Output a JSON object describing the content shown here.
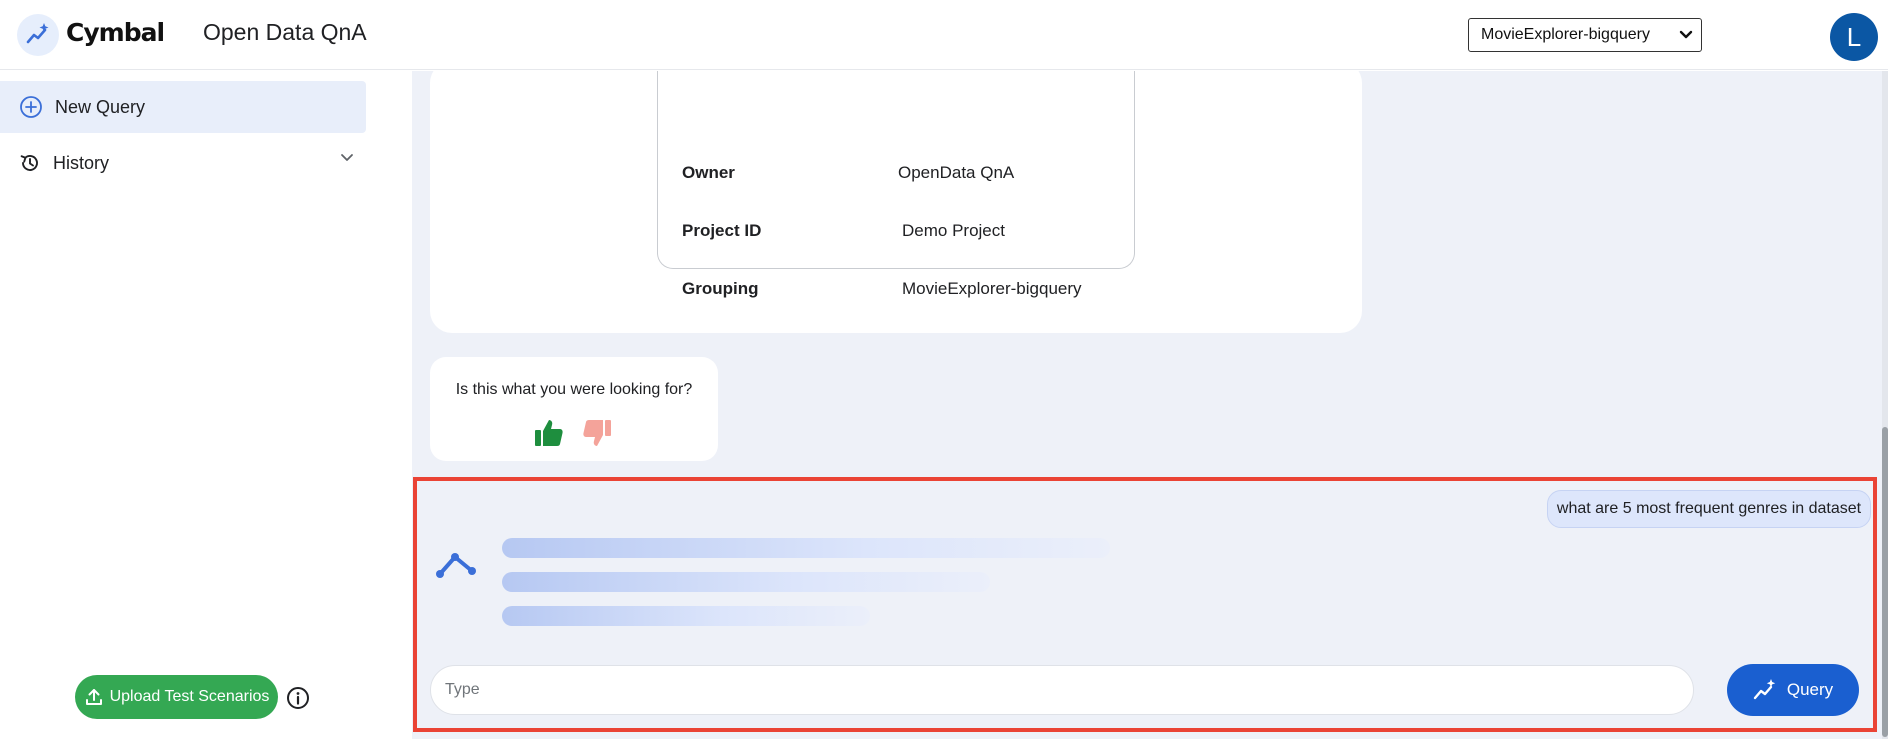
{
  "header": {
    "brand": "Cymbal",
    "app_title": "Open Data QnA",
    "dataset_selected": "MovieExplorer-bigquery",
    "avatar_initial": "L"
  },
  "sidebar": {
    "new_query_label": "New Query",
    "history_label": "History",
    "upload_label": "Upload Test Scenarios"
  },
  "meta": {
    "rows": [
      {
        "key": "Owner",
        "value": "OpenData QnA"
      },
      {
        "key": "Project ID",
        "value": "Demo Project"
      },
      {
        "key": "Grouping",
        "value": "MovieExplorer-bigquery"
      }
    ]
  },
  "feedback": {
    "question": "Is this what you were looking for?"
  },
  "chat": {
    "user_message": "what are 5 most frequent genres in dataset",
    "input_placeholder": "Type",
    "query_label": "Query"
  },
  "colors": {
    "accent": "#1a5fd0",
    "upload_green": "#34a853",
    "highlight_red": "#ea4335",
    "avatar_blue": "#0b57a4"
  },
  "icons": {
    "logo": "sparkle-chart-icon",
    "new_query": "plus-circle-icon",
    "history": "history-icon",
    "upload": "upload-icon",
    "info": "info-icon",
    "thumbs_up": "thumbs-up-icon",
    "thumbs_down": "thumbs-down-icon",
    "bot": "bot-chart-icon",
    "query": "sparkle-chart-icon"
  }
}
